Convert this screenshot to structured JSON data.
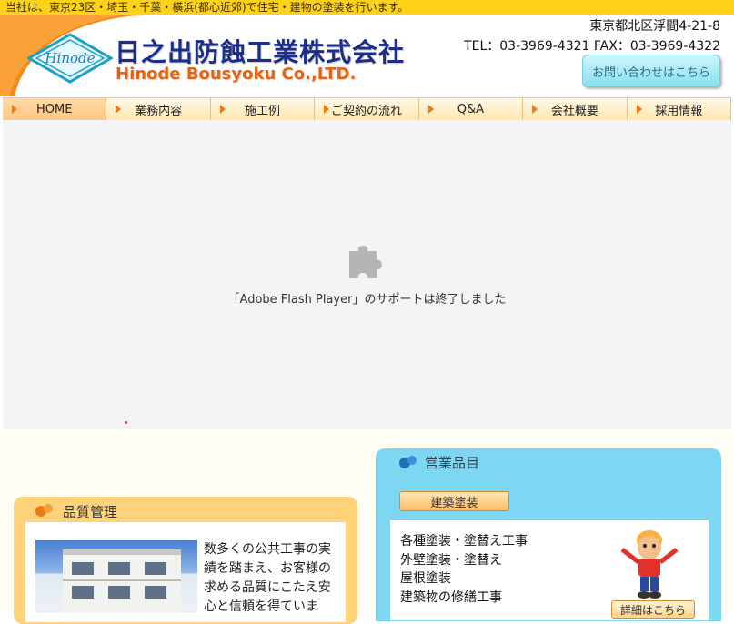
{
  "topbar": {
    "text": "当社は、東京23区・埼玉・千葉・横浜(都心近郊)で住宅・建物の塗装を行います。"
  },
  "header": {
    "company_ja": "日之出防蝕工業株式会社",
    "company_en": "Hinode Bousyoku Co.,LTD.",
    "logo_text": "Hinode",
    "address": "東京都北区浮間4-21-8",
    "tel": "TEL：03-3969-4321 FAX：03-3969-4322",
    "contact_label": "お問い合わせはこちら"
  },
  "nav": {
    "items": [
      {
        "label": "HOME"
      },
      {
        "label": "業務内容"
      },
      {
        "label": "施工例"
      },
      {
        "label": "ご契約の流れ"
      },
      {
        "label": "Q&A"
      },
      {
        "label": "会社概要"
      },
      {
        "label": "採用情報"
      }
    ]
  },
  "flash": {
    "message": "「Adobe Flash Player」のサポートは終了しました"
  },
  "quality": {
    "title": "品質管理",
    "text": "数多くの公共工事の実績を踏まえ、お客様の求める品質にこたえ安心と信頼を得ていま"
  },
  "products": {
    "title": "営業品目",
    "category_button": "建築塗装",
    "items": [
      "各種塗装・塗替え工事",
      "外壁塗装・塗替え",
      "屋根塗装",
      "建築物の修繕工事"
    ],
    "detail_button": "詳細はこちら"
  },
  "colors": {
    "topbar": "#ffd21a",
    "brand_blue": "#1b2e8c",
    "brand_orange": "#e8620f",
    "nav_arrow": "#f07a12",
    "products_panel": "#7dd7f3",
    "quality_panel": "#ffd37a"
  }
}
